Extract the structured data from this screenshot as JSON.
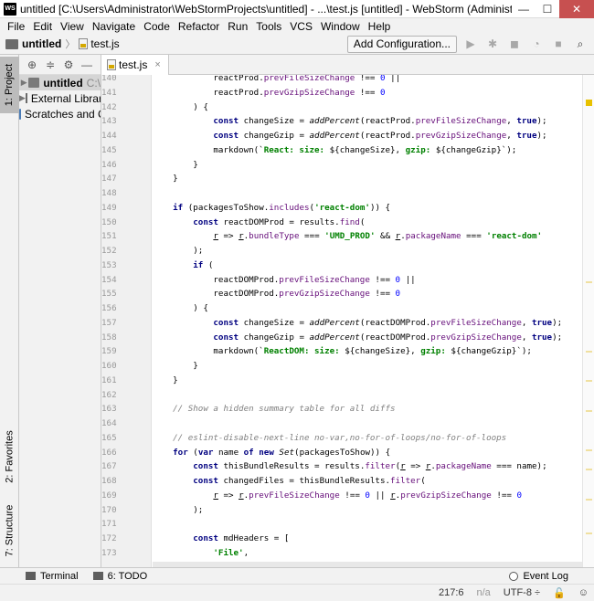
{
  "window": {
    "title": "untitled [C:\\Users\\Administrator\\WebStormProjects\\untitled] - ...\\test.js [untitled] - WebStorm (Administrator)",
    "logo_text": "WS",
    "minimize": "—",
    "maximize": "☐",
    "close": "✕"
  },
  "menu": [
    "File",
    "Edit",
    "View",
    "Navigate",
    "Code",
    "Refactor",
    "Run",
    "Tools",
    "VCS",
    "Window",
    "Help"
  ],
  "nav": {
    "project": "untitled",
    "file": "test.js",
    "add_configuration": "Add Configuration...",
    "run_icon": "▶",
    "debug_icon": "✱",
    "coverage_icon": "◼",
    "profile_icon": "◔",
    "stop_icon": "■",
    "search_icon": "⌕"
  },
  "left_strip": {
    "project_tab": "1: Project",
    "favorites_tab": "2: Favorites",
    "structure_tab": "7: Structure"
  },
  "project_panel": {
    "tools": [
      "⊕",
      "≑",
      "⚙",
      "—"
    ],
    "items": [
      {
        "label": "untitled",
        "suffix": "C:\\"
      },
      {
        "label": "External Libraries"
      },
      {
        "label": "Scratches and Consoles"
      }
    ]
  },
  "editor": {
    "tab": "test.js",
    "close": "×",
    "line_numbers": [
      "140",
      "141",
      "142",
      "143",
      "144",
      "145",
      "146",
      "147",
      "148",
      "149",
      "150",
      "151",
      "152",
      "153",
      "154",
      "155",
      "156",
      "157",
      "158",
      "159",
      "160",
      "161",
      "162",
      "163",
      "164",
      "165",
      "166",
      "167",
      "168",
      "169",
      "170",
      "171",
      "172",
      "173"
    ],
    "code": [
      [
        [
          "            ",
          ""
        ],
        [
          "reactProd",
          ""
        ],
        [
          ".",
          ""
        ],
        [
          "prevFileSizeChange",
          "prop"
        ],
        [
          " !== ",
          ""
        ],
        [
          "0",
          "num"
        ],
        [
          " ||",
          ""
        ]
      ],
      [
        [
          "            ",
          ""
        ],
        [
          "reactProd",
          ""
        ],
        [
          ".",
          ""
        ],
        [
          "prevGzipSizeChange",
          "prop"
        ],
        [
          " !== ",
          ""
        ],
        [
          "0",
          "num"
        ]
      ],
      [
        [
          "        ) {",
          ""
        ]
      ],
      [
        [
          "            ",
          ""
        ],
        [
          "const",
          "kw"
        ],
        [
          " changeSize = ",
          ""
        ],
        [
          "addPercent",
          "fn"
        ],
        [
          "(reactProd.",
          ""
        ],
        [
          "prevFileSizeChange",
          "prop"
        ],
        [
          ", ",
          ""
        ],
        [
          "true",
          "kw"
        ],
        [
          ");",
          ""
        ]
      ],
      [
        [
          "            ",
          ""
        ],
        [
          "const",
          "kw"
        ],
        [
          " changeGzip = ",
          ""
        ],
        [
          "addPercent",
          "fn"
        ],
        [
          "(reactProd.",
          ""
        ],
        [
          "prevGzipSizeChange",
          "prop"
        ],
        [
          ", ",
          ""
        ],
        [
          "true",
          "kw"
        ],
        [
          ");",
          ""
        ]
      ],
      [
        [
          "            markdown(`",
          ""
        ],
        [
          "React: size:",
          "str"
        ],
        [
          " ${changeSize}, ",
          ""
        ],
        [
          "gzip:",
          "str"
        ],
        [
          " ${changeGzip}`);",
          ""
        ]
      ],
      [
        [
          "        }",
          ""
        ]
      ],
      [
        [
          "    }",
          ""
        ]
      ],
      [
        [
          "",
          ""
        ]
      ],
      [
        [
          "    ",
          ""
        ],
        [
          "if",
          "kw"
        ],
        [
          " (packagesToShow.",
          ""
        ],
        [
          "includes",
          "prop"
        ],
        [
          "(",
          ""
        ],
        [
          "'react-dom'",
          "str"
        ],
        [
          ")) {",
          ""
        ]
      ],
      [
        [
          "        ",
          ""
        ],
        [
          "const",
          "kw"
        ],
        [
          " reactDOMProd = results.",
          ""
        ],
        [
          "find",
          "prop"
        ],
        [
          "(",
          ""
        ]
      ],
      [
        [
          "            ",
          ""
        ],
        [
          "r",
          "par"
        ],
        [
          " => ",
          ""
        ],
        [
          "r",
          "par"
        ],
        [
          ".",
          ""
        ],
        [
          "bundleType",
          "prop"
        ],
        [
          " === ",
          ""
        ],
        [
          "'UMD_PROD'",
          "str"
        ],
        [
          " && ",
          ""
        ],
        [
          "r",
          "par"
        ],
        [
          ".",
          ""
        ],
        [
          "packageName",
          "prop"
        ],
        [
          " === ",
          ""
        ],
        [
          "'react-dom'",
          "str"
        ]
      ],
      [
        [
          "        );",
          ""
        ]
      ],
      [
        [
          "        ",
          ""
        ],
        [
          "if",
          "kw"
        ],
        [
          " (",
          ""
        ]
      ],
      [
        [
          "            reactDOMProd.",
          ""
        ],
        [
          "prevFileSizeChange",
          "prop"
        ],
        [
          " !== ",
          ""
        ],
        [
          "0",
          "num"
        ],
        [
          " ||",
          ""
        ]
      ],
      [
        [
          "            reactDOMProd.",
          ""
        ],
        [
          "prevGzipSizeChange",
          "prop"
        ],
        [
          " !== ",
          ""
        ],
        [
          "0",
          "num"
        ]
      ],
      [
        [
          "        ) {",
          ""
        ]
      ],
      [
        [
          "            ",
          ""
        ],
        [
          "const",
          "kw"
        ],
        [
          " changeSize = ",
          ""
        ],
        [
          "addPercent",
          "fn"
        ],
        [
          "(reactDOMProd.",
          ""
        ],
        [
          "prevFileSizeChange",
          "prop"
        ],
        [
          ", ",
          ""
        ],
        [
          "true",
          "kw"
        ],
        [
          ");",
          ""
        ]
      ],
      [
        [
          "            ",
          ""
        ],
        [
          "const",
          "kw"
        ],
        [
          " changeGzip = ",
          ""
        ],
        [
          "addPercent",
          "fn"
        ],
        [
          "(reactDOMProd.",
          ""
        ],
        [
          "prevGzipSizeChange",
          "prop"
        ],
        [
          ", ",
          ""
        ],
        [
          "true",
          "kw"
        ],
        [
          ");",
          ""
        ]
      ],
      [
        [
          "            markdown(`",
          ""
        ],
        [
          "ReactDOM: size:",
          "str"
        ],
        [
          " ${changeSize}, ",
          ""
        ],
        [
          "gzip:",
          "str"
        ],
        [
          " ${changeGzip}`);",
          ""
        ]
      ],
      [
        [
          "        }",
          ""
        ]
      ],
      [
        [
          "    }",
          ""
        ]
      ],
      [
        [
          "",
          ""
        ]
      ],
      [
        [
          "    ",
          ""
        ],
        [
          "// Show a hidden summary table for all diffs",
          "cm"
        ]
      ],
      [
        [
          "",
          ""
        ]
      ],
      [
        [
          "    ",
          ""
        ],
        [
          "// eslint-disable-next-line no-var,no-for-of-loops/no-for-of-loops",
          "cm"
        ]
      ],
      [
        [
          "    ",
          ""
        ],
        [
          "for",
          "kw"
        ],
        [
          " (",
          ""
        ],
        [
          "var",
          "kw"
        ],
        [
          " name ",
          ""
        ],
        [
          "of",
          "kw"
        ],
        [
          " ",
          ""
        ],
        [
          "new",
          "kw"
        ],
        [
          " ",
          ""
        ],
        [
          "Set",
          "fn"
        ],
        [
          "(packagesToShow)) {",
          ""
        ]
      ],
      [
        [
          "        ",
          ""
        ],
        [
          "const",
          "kw"
        ],
        [
          " thisBundleResults = results.",
          ""
        ],
        [
          "filter",
          "prop"
        ],
        [
          "(",
          ""
        ],
        [
          "r",
          "par"
        ],
        [
          " => ",
          ""
        ],
        [
          "r",
          "par"
        ],
        [
          ".",
          ""
        ],
        [
          "packageName",
          "prop"
        ],
        [
          " === name);",
          ""
        ]
      ],
      [
        [
          "        ",
          ""
        ],
        [
          "const",
          "kw"
        ],
        [
          " changedFiles = thisBundleResults.",
          ""
        ],
        [
          "filter",
          "prop"
        ],
        [
          "(",
          ""
        ]
      ],
      [
        [
          "            ",
          ""
        ],
        [
          "r",
          "par"
        ],
        [
          " => ",
          ""
        ],
        [
          "r",
          "par"
        ],
        [
          ".",
          ""
        ],
        [
          "prevFileSizeChange",
          "prop"
        ],
        [
          " !== ",
          ""
        ],
        [
          "0",
          "num"
        ],
        [
          " || ",
          ""
        ],
        [
          "r",
          "par"
        ],
        [
          ".",
          ""
        ],
        [
          "prevGzipSizeChange",
          "prop"
        ],
        [
          " !== ",
          ""
        ],
        [
          "0",
          "num"
        ]
      ],
      [
        [
          "        );",
          ""
        ]
      ],
      [
        [
          "",
          ""
        ]
      ],
      [
        [
          "        ",
          ""
        ],
        [
          "const",
          "kw"
        ],
        [
          " mdHeaders = [",
          ""
        ]
      ],
      [
        [
          "            ",
          ""
        ],
        [
          "'File'",
          "str"
        ],
        [
          ",",
          ""
        ]
      ]
    ]
  },
  "scroll_marks": [
    {
      "pos": 0.05,
      "color": "#e8c100"
    },
    {
      "pos": 0.42,
      "color": "#f0e0a0"
    },
    {
      "pos": 0.56,
      "color": "#f0e0a0"
    },
    {
      "pos": 0.62,
      "color": "#f0e0a0"
    },
    {
      "pos": 0.68,
      "color": "#f0e0a0"
    },
    {
      "pos": 0.76,
      "color": "#f0e0a0"
    },
    {
      "pos": 0.8,
      "color": "#f0e0a0"
    },
    {
      "pos": 0.86,
      "color": "#f0e0a0"
    },
    {
      "pos": 0.93,
      "color": "#f0e0a0"
    }
  ],
  "bottom_bar": {
    "terminal": "Terminal",
    "todo": "6: TODO",
    "event_log": "Event Log"
  },
  "status": {
    "position": "217:6",
    "na": "n/a",
    "encoding": "UTF-8 ÷",
    "lock_icon": "🔓",
    "hector_icon": "☺"
  }
}
